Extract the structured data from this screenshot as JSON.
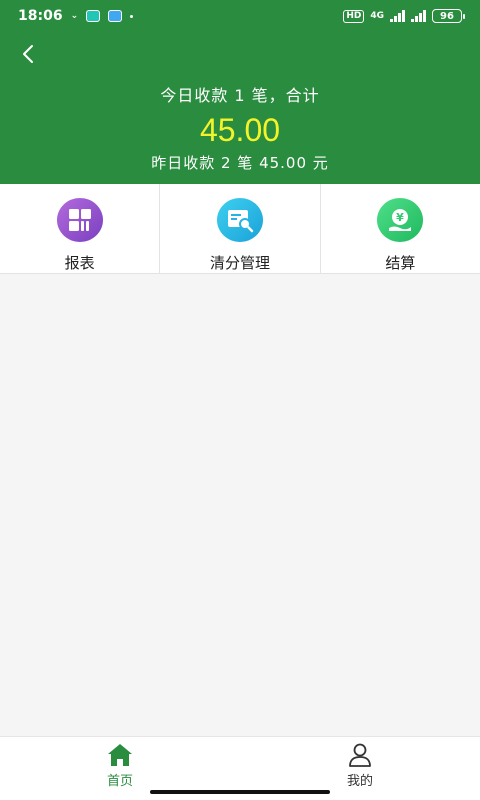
{
  "status_bar": {
    "time": "18:06",
    "network": "4G",
    "battery": "96"
  },
  "header": {
    "back_icon": "chevron-left-icon",
    "today_text": "今日收款 1 笔，合计",
    "today_amount": "45.00",
    "yesterday_text": "昨日收款 2 笔 45.00 元"
  },
  "menu": {
    "items": [
      {
        "label": "报表",
        "icon": "report-grid-icon",
        "color": "#8e4fd0"
      },
      {
        "label": "清分管理",
        "icon": "clearing-document-icon",
        "color": "#25b3e4"
      },
      {
        "label": "结算",
        "icon": "settlement-yuan-icon",
        "color": "#2ccb6f"
      }
    ]
  },
  "bottom_nav": {
    "items": [
      {
        "label": "首页",
        "icon": "home-icon",
        "active": true
      },
      {
        "label": "我的",
        "icon": "user-icon",
        "active": false
      }
    ]
  },
  "colors": {
    "brand_green": "#2a8c3f",
    "amount_yellow": "#f3f32a",
    "background": "#f5f5f5"
  }
}
